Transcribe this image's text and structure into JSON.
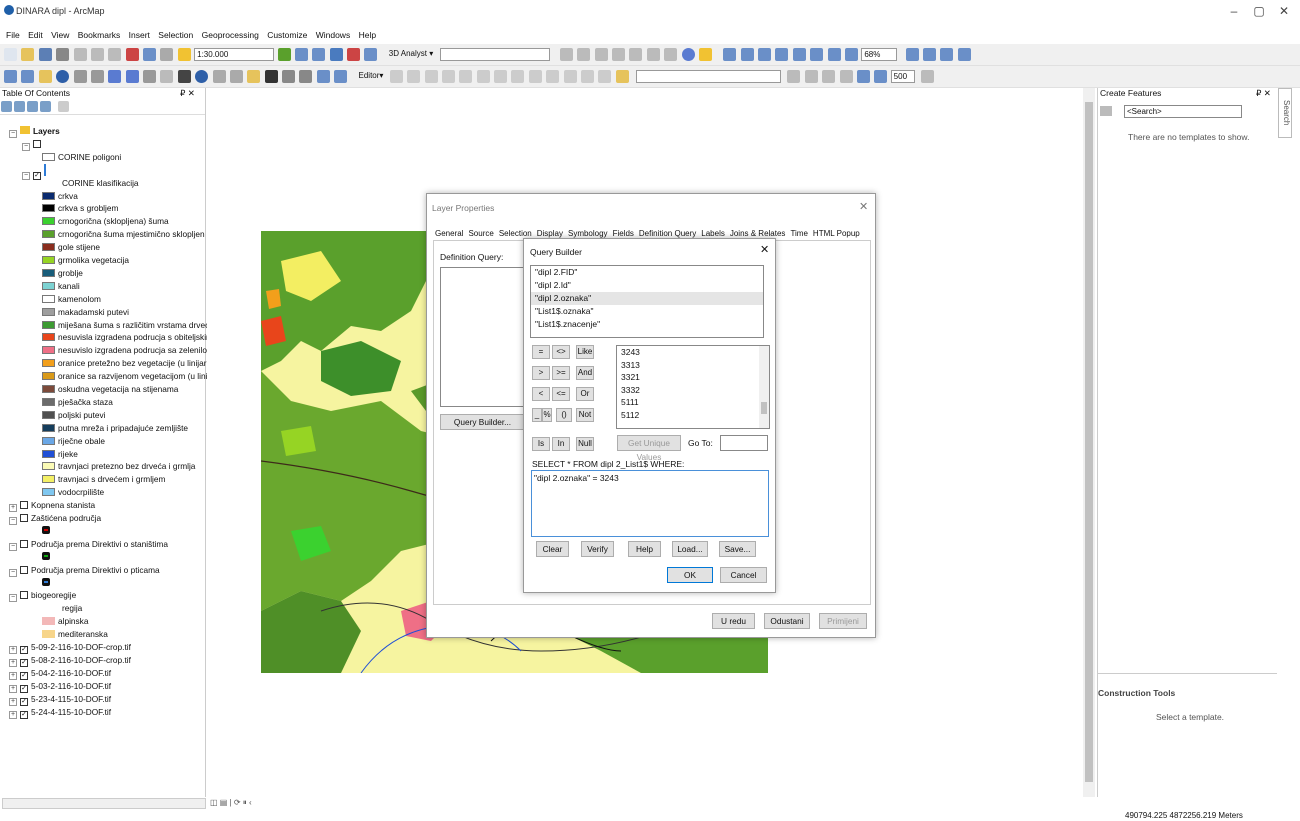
{
  "window": {
    "title": "DINARA dipl - ArcMap",
    "min": "–",
    "max": "▢",
    "close": "✕"
  },
  "menu": [
    "File",
    "Edit",
    "View",
    "Bookmarks",
    "Insert",
    "Selection",
    "Geoprocessing",
    "Customize",
    "Windows",
    "Help"
  ],
  "toolbar": {
    "scale": "1:30.000",
    "analyst": "3D Analyst ▾",
    "editor": "Editor▾",
    "zoom": "68%",
    "field500": "500"
  },
  "toc": {
    "title": "Table Of Contents",
    "pin": "₽ ✕",
    "layers": "Layers",
    "rows": [
      {
        "t": "CORINE poligoni",
        "type": "poly"
      },
      {
        "t": "CORINE klasifikacija",
        "type": "head"
      },
      {
        "t": "crkva",
        "c": "#0a2a6e"
      },
      {
        "t": "crkva s grobljem",
        "c": "#000000"
      },
      {
        "t": "crnogorična (sklopljena) šuma",
        "c": "#3bd12f"
      },
      {
        "t": "crnogorična šuma mjestimično sklopljen",
        "c": "#5aa02c"
      },
      {
        "t": "gole stijene",
        "c": "#8a2d1e"
      },
      {
        "t": "grmolika vegetacija",
        "c": "#96d424"
      },
      {
        "t": "groblje",
        "c": "#185d7a"
      },
      {
        "t": "kanali",
        "c": "#7dd3d3"
      },
      {
        "t": "kamenolom",
        "c": "#ffffff"
      },
      {
        "t": "makadamski putevi",
        "c": "#9e9e9e"
      },
      {
        "t": "miješana šuma s različitim vrstama drveć",
        "c": "#3d9b33"
      },
      {
        "t": "nesuvisla izgradena podrucja s obiteljskir",
        "c": "#e8451b"
      },
      {
        "t": "nesuvislo izgradena podrucja sa zelenilor",
        "c": "#ef6f86"
      },
      {
        "t": "oranice pretežno bez vegetacije  (u linijar",
        "c": "#f29f1b"
      },
      {
        "t": "oranice sa razvijenom vegetacijom (u lini",
        "c": "#d99a1a"
      },
      {
        "t": "oskudna vegetacija na stijenama",
        "c": "#7c4a3a"
      },
      {
        "t": "pješačka staza",
        "c": "#6b6b6b"
      },
      {
        "t": "poljski putevi",
        "c": "#4f4f4f"
      },
      {
        "t": "putna mreža i pripadajuće zemljište",
        "c": "#153d5c"
      },
      {
        "t": "riječne obale",
        "c": "#6aa7e6"
      },
      {
        "t": "rijeke",
        "c": "#1f4fd6"
      },
      {
        "t": "travnjaci pretezno bez drveća i grmlja",
        "c": "#fbfbb6"
      },
      {
        "t": "travnjaci s drvećem i grmljem",
        "c": "#f4f066"
      },
      {
        "t": "vodocrpilište",
        "c": "#7fc7f0"
      }
    ],
    "groups": [
      "Kopnena stanista",
      "Zaštićena područja",
      "Područja prema Direktivi o staništima",
      "Područja prema Direktivi o pticama",
      "biogeoregije"
    ],
    "bioField": "regija",
    "bio": [
      {
        "t": "alpinska",
        "c": "#f3b8b8"
      },
      {
        "t": "mediteranska",
        "c": "#f7d58a"
      }
    ],
    "rasters": [
      "5-09-2-116-10-DOF-crop.tif",
      "5-08-2-116-10-DOF-crop.tif",
      "5-04-2-116-10-DOF.tif",
      "5-03-2-116-10-DOF.tif",
      "5-23-4-115-10-DOF.tif",
      "5-24-4-115-10-DOF.tif"
    ]
  },
  "layerProps": {
    "title": "Layer Properties",
    "tabs": [
      "General",
      "Source",
      "Selection",
      "Display",
      "Symbology",
      "Fields",
      "Definition Query",
      "Labels",
      "Joins & Relates",
      "Time",
      "HTML Popup"
    ],
    "defq": "Definition Query:",
    "qb": "Query Builder...",
    "ok": "U redu",
    "cancel": "Odustani",
    "apply": "Primijeni"
  },
  "queryBuilder": {
    "title": "Query Builder",
    "fields": [
      "\"dipl 2.FID\"",
      "\"dipl 2.Id\"",
      "\"dipl 2.oznaka\"",
      "\"List1$.oznaka\"",
      "\"List1$.znacenje\""
    ],
    "ops": [
      "=",
      "<>",
      "Like",
      ">",
      ">=",
      "And",
      "<",
      "<=",
      "Or",
      "_",
      "%",
      "()",
      "Not",
      "Is",
      "In",
      "Null"
    ],
    "values": [
      "3243",
      "3313",
      "3321",
      "3332",
      "5111",
      "5112"
    ],
    "unique": "Get Unique Values",
    "goto": "Go To:",
    "select": "SELECT * FROM dipl 2_List1$ WHERE:",
    "expr": "\"dipl 2.oznaka\" = 3243",
    "clear": "Clear",
    "verify": "Verify",
    "help": "Help",
    "load": "Load...",
    "save": "Save...",
    "ok": "OK",
    "cancel": "Cancel"
  },
  "createFeatures": {
    "title": "Create Features",
    "search": "<Search>",
    "empty": "There are no templates to show.",
    "search_tab": "Search"
  },
  "construction": {
    "title": "Construction Tools",
    "msg": "Select a template."
  },
  "status": {
    "coords": "490794.225  4872256.219 Meters"
  }
}
